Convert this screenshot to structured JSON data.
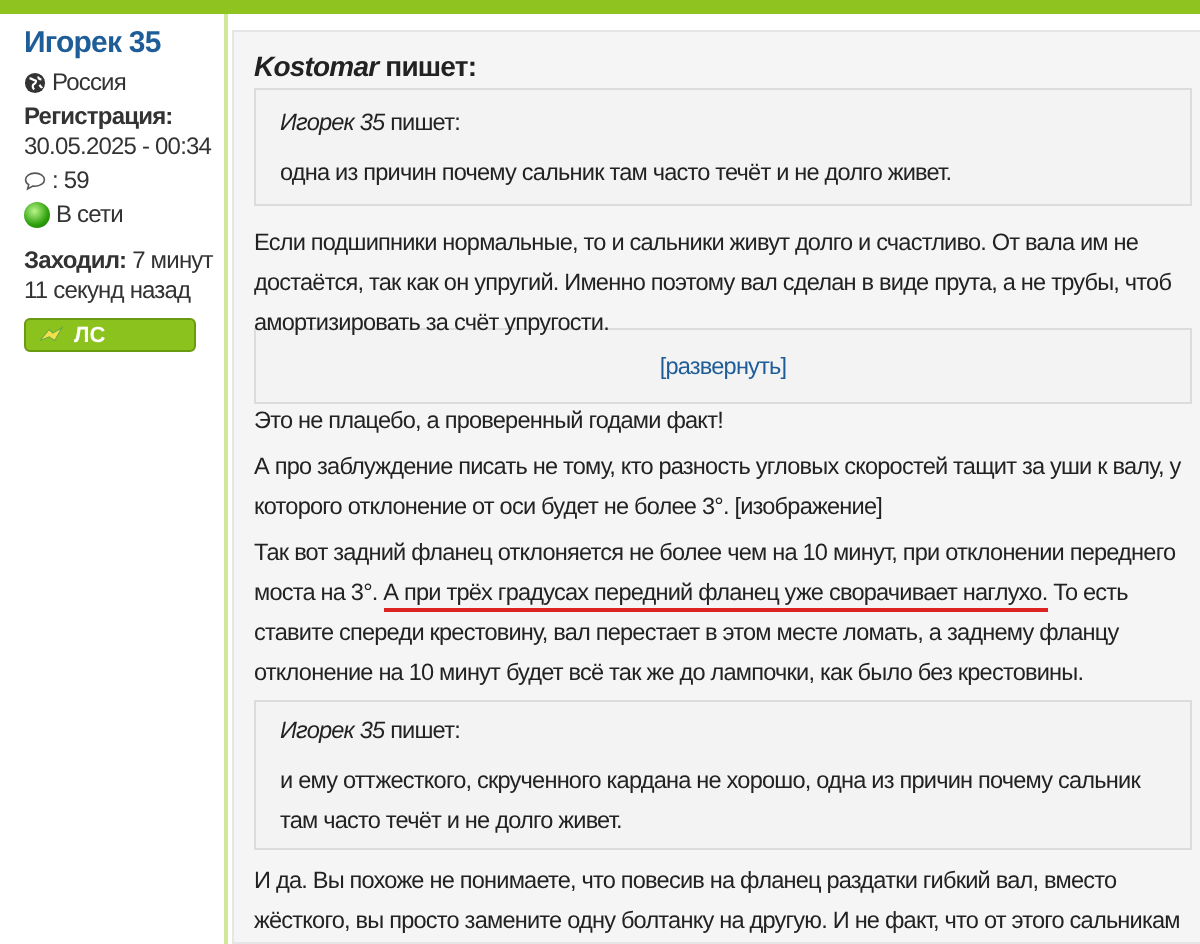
{
  "user": {
    "name": "Игорек 35",
    "country": "Россия",
    "registration_label": "Регистрация:",
    "registration_date": "30.05.2025 - 00:34",
    "messages": ": 59",
    "status": "В сети",
    "online": true,
    "last_visit_label": "Заходил:",
    "last_visit": "7 минут 11 секунд назад",
    "pm_button": "ЛС"
  },
  "post": {
    "quote": {
      "author_line": "*Kostomar* пишет:",
      "inner_author": "*Игорек 35* пишет:",
      "inner_text": "одна из причин почему сальник там часто течёт и не долго живет."
    },
    "blocks": [
      {
        "kind": "paragraph",
        "text": "Если подшипники нормальные, то и сальники живут долго и счастливо. От вала им не достаётся, так как он упругий. Именно поэтому вал сделан в виде прута, а не трубы, чтоб амортизировать за счёт упругости."
      },
      {
        "kind": "spoiler",
        "label": "[развернуть]"
      },
      {
        "kind": "paragraph",
        "text": "Это не плацебо, а проверенный годами факт!"
      },
      {
        "kind": "paragraph",
        "text": "А про заблуждение писать не тому, кто разность угловых скоростей тащит за уши к валу, у которого отклонение от оси будет не более 3°. [изображение]"
      },
      {
        "kind": "marked_paragraph",
        "segments": [
          {
            "text": "Так вот задний фланец отклоняется не более чем на 10 минут, при отклонении переднего моста на 3°. ",
            "underlined": false
          },
          {
            "text": "А при трёх градусах передний фланец уже сворачивает наглухо.",
            "underlined": true
          },
          {
            "text": " То есть ставите спереди крестовину, вал перестает в этом месте ломать, а заднему фланцу отклонение на 10 минут будет всё так же до лампочки, как было без крестовины.",
            "underlined": false
          }
        ]
      },
      {
        "kind": "quote",
        "author": "*Игорек 35* пишет:",
        "text": "и ему оттжесткого, скрученного кардана не хорошо, одна из причин почему сальник там часто течёт и не долго живет."
      },
      {
        "kind": "paragraph",
        "text": "И да. Вы похоже не понимаете, что повесив на фланец раздатки гибкий вал, вместо жёсткого, вы просто замените одну болтанку на другую. И не факт, что от этого сальникам"
      }
    ]
  }
}
